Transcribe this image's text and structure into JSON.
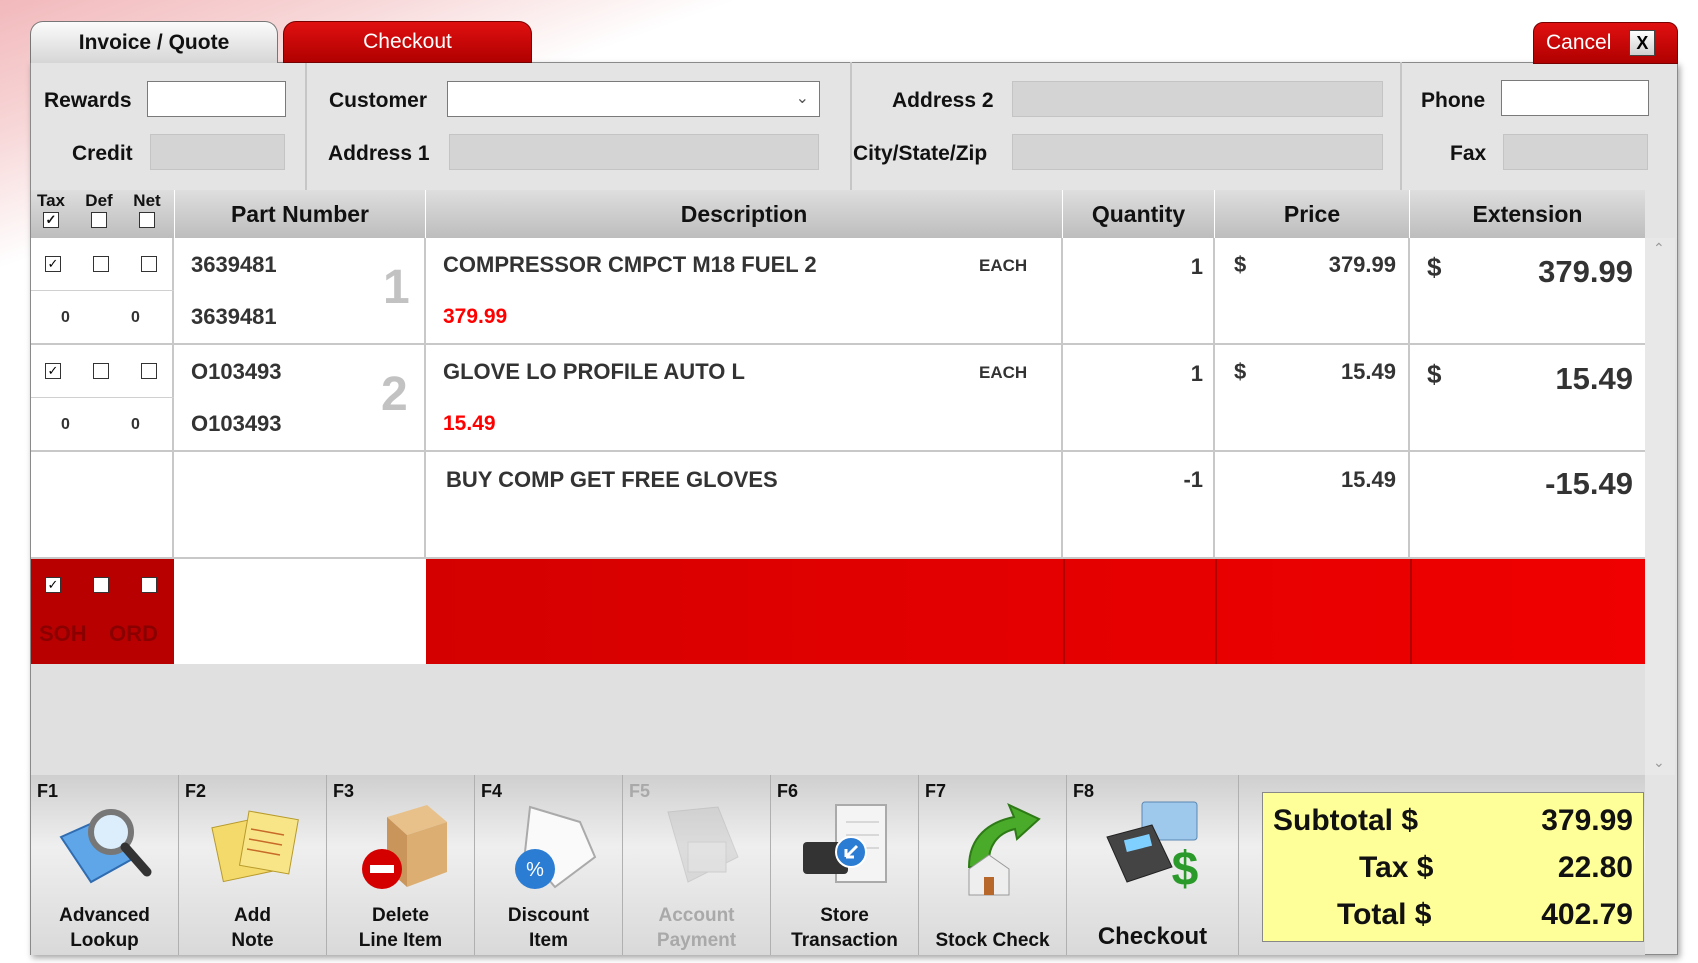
{
  "tabs": {
    "invoice": "Invoice / Quote",
    "checkout": "Checkout",
    "cancel": "Cancel",
    "close_glyph": "X"
  },
  "header": {
    "rewards_label": "Rewards",
    "credit_label": "Credit",
    "customer_label": "Customer",
    "address1_label": "Address 1",
    "address2_label": "Address 2",
    "city_label": "City/State/Zip",
    "phone_label": "Phone",
    "fax_label": "Fax",
    "rewards_value": "",
    "customer_value": "",
    "phone_value": ""
  },
  "grid": {
    "columns": {
      "tax": "Tax",
      "def": "Def",
      "net": "Net",
      "part": "Part Number",
      "desc": "Description",
      "qty": "Quantity",
      "price": "Price",
      "ext": "Extension"
    },
    "lines": [
      {
        "num": "1",
        "tax": true,
        "def": false,
        "net": false,
        "soh": "0",
        "ord": "0",
        "part": "3639481",
        "part2": "3639481",
        "desc": "COMPRESSOR CMPCT M18 FUEL 2",
        "unit": "EACH",
        "sub_price": "379.99",
        "qty": "1",
        "cur": "$",
        "price": "379.99",
        "ext": "379.99"
      },
      {
        "num": "2",
        "tax": true,
        "def": false,
        "net": false,
        "soh": "0",
        "ord": "0",
        "part": "O103493",
        "part2": "O103493",
        "desc": "GLOVE LO PROFILE AUTO L",
        "unit": "EACH",
        "sub_price": "15.49",
        "qty": "1",
        "cur": "$",
        "price": "15.49",
        "ext": "15.49"
      }
    ],
    "promo": {
      "desc": "BUY COMP GET FREE GLOVES",
      "qty": "-1",
      "price": "15.49",
      "ext": "-15.49"
    },
    "edit": {
      "soh": "SOH",
      "ord": "ORD"
    }
  },
  "function_keys": [
    {
      "key": "F1",
      "label1": "Advanced",
      "label2": "Lookup",
      "icon": "magnifier-folder-icon",
      "enabled": true
    },
    {
      "key": "F2",
      "label1": "Add",
      "label2": "Note",
      "icon": "notes-icon",
      "enabled": true
    },
    {
      "key": "F3",
      "label1": "Delete",
      "label2": "Line Item",
      "icon": "box-delete-icon",
      "enabled": true
    },
    {
      "key": "F4",
      "label1": "Discount",
      "label2": "Item",
      "icon": "discount-icon",
      "enabled": true
    },
    {
      "key": "F5",
      "label1": "Account",
      "label2": "Payment",
      "icon": "account-payment-icon",
      "enabled": false
    },
    {
      "key": "F6",
      "label1": "Store",
      "label2": "Transaction",
      "icon": "store-transaction-icon",
      "enabled": true
    },
    {
      "key": "F7",
      "label1": "",
      "label2": "Stock Check",
      "icon": "stock-check-icon",
      "enabled": true
    },
    {
      "key": "F8",
      "label1": "",
      "label2": "Checkout",
      "icon": "checkout-terminal-icon",
      "enabled": true
    }
  ],
  "totals": {
    "subtotal_label": "Subtotal $",
    "subtotal": "379.99",
    "tax_label": "Tax $",
    "tax": "22.80",
    "total_label": "Total $",
    "total": "402.79"
  },
  "colors": {
    "accent_red": "#d00000",
    "totals_bg": "#ffff99",
    "sub_price": "#ff0000"
  }
}
